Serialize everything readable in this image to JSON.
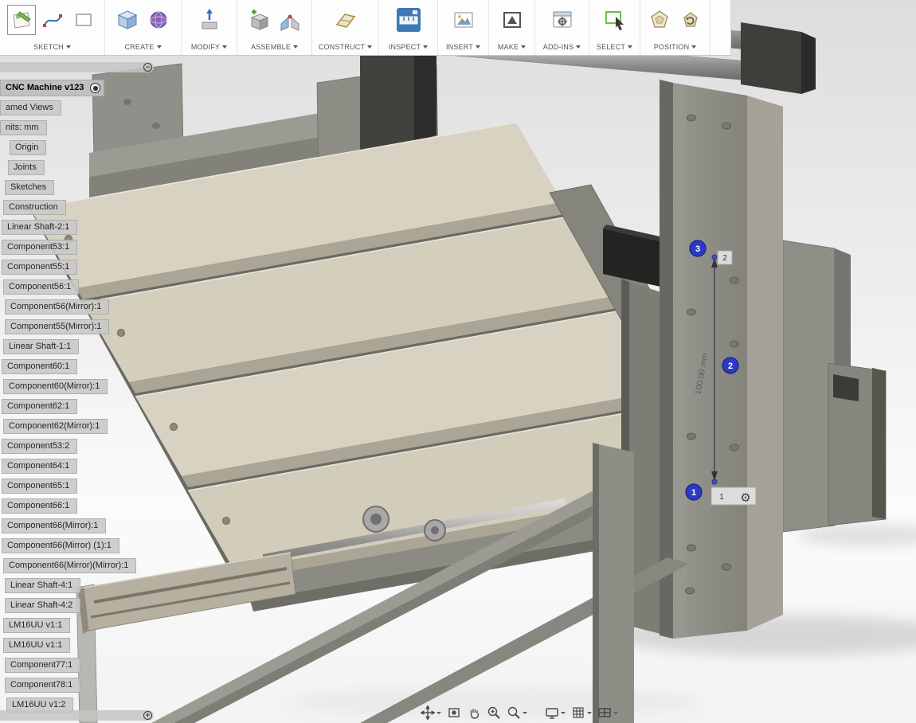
{
  "colors": {
    "balloon_blue": "#2b3ac6",
    "inspect_active_blue": "#3f79b5",
    "select_green": "#6cbf4a"
  },
  "toolbar": {
    "groups": [
      {
        "label": "SKETCH"
      },
      {
        "label": "CREATE"
      },
      {
        "label": "MODIFY"
      },
      {
        "label": "ASSEMBLE"
      },
      {
        "label": "CONSTRUCT"
      },
      {
        "label": "INSPECT"
      },
      {
        "label": "INSERT"
      },
      {
        "label": "MAKE"
      },
      {
        "label": "ADD-INS"
      },
      {
        "label": "SELECT"
      },
      {
        "label": "POSITION"
      }
    ]
  },
  "browser": {
    "root_label": "CNC Machine v123",
    "items": [
      {
        "label": "amed Views",
        "indent": 0
      },
      {
        "label": "nits: mm",
        "indent": 0
      },
      {
        "label": "Origin",
        "indent": 12
      },
      {
        "label": "Joints",
        "indent": 10
      },
      {
        "label": "Sketches",
        "indent": 6
      },
      {
        "label": "Construction",
        "indent": 4
      },
      {
        "label": "Linear Shaft-2:1",
        "indent": 2
      },
      {
        "label": "Component53:1",
        "indent": 2
      },
      {
        "label": "Component55:1",
        "indent": 2
      },
      {
        "label": "Component56:1",
        "indent": 4
      },
      {
        "label": "Component56(Mirror):1",
        "indent": 6
      },
      {
        "label": "Component55(Mirror):1",
        "indent": 6
      },
      {
        "label": "Linear Shaft-1:1",
        "indent": 4
      },
      {
        "label": "Component60:1",
        "indent": 2
      },
      {
        "label": "Component60(Mirror):1",
        "indent": 4
      },
      {
        "label": "Component62:1",
        "indent": 2
      },
      {
        "label": "Component62(Mirror):1",
        "indent": 4
      },
      {
        "label": "Component53:2",
        "indent": 2
      },
      {
        "label": "Component64:1",
        "indent": 2
      },
      {
        "label": "Component65:1",
        "indent": 2
      },
      {
        "label": "Component66:1",
        "indent": 2
      },
      {
        "label": "Component66(Mirror):1",
        "indent": 2
      },
      {
        "label": "Component66(Mirror) (1):1",
        "indent": 2
      },
      {
        "label": "Component66(Mirror)(Mirror):1",
        "indent": 4
      },
      {
        "label": "Linear Shaft-4:1",
        "indent": 6
      },
      {
        "label": "Linear Shaft-4:2",
        "indent": 6
      },
      {
        "label": "LM16UU v1:1",
        "indent": 4
      },
      {
        "label": "LM16UU v1:1",
        "indent": 4
      },
      {
        "label": "Component77:1",
        "indent": 6
      },
      {
        "label": "Component78:1",
        "indent": 6
      },
      {
        "label": "LM16UU v1:2",
        "indent": 8
      }
    ]
  },
  "panel_controls": {
    "collapse_glyph": "−",
    "expand_glyph": "+"
  },
  "canvas": {
    "dimension_label": "100.00 mm",
    "measure_points": [
      {
        "id": "1"
      },
      {
        "id": "2"
      }
    ],
    "balloons": [
      {
        "n": "1"
      },
      {
        "n": "2"
      },
      {
        "n": "3"
      }
    ],
    "gear_glyph": "⚙"
  }
}
